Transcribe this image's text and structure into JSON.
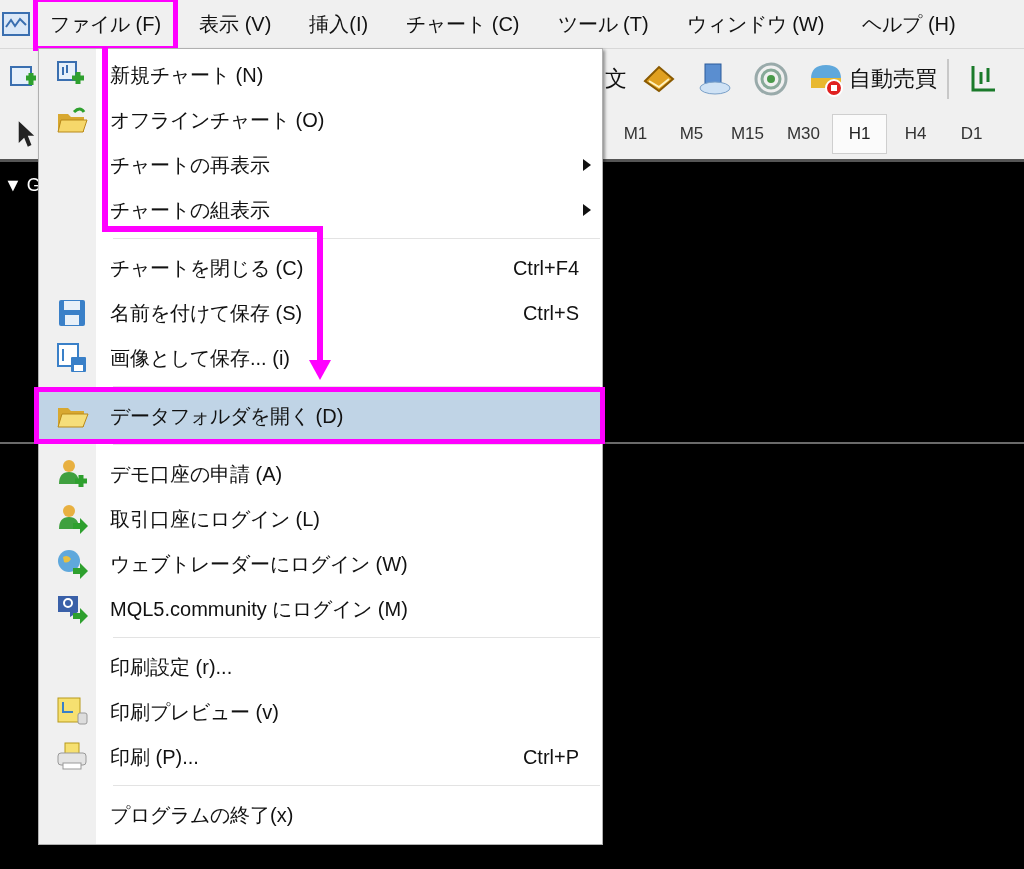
{
  "menubar": [
    {
      "label": "ファイル (F)",
      "highlighted": true
    },
    {
      "label": "表示 (V)",
      "highlighted": false
    },
    {
      "label": "挿入(I)",
      "highlighted": false
    },
    {
      "label": "チャート (C)",
      "highlighted": false
    },
    {
      "label": "ツール (T)",
      "highlighted": false
    },
    {
      "label": "ウィンドウ (W)",
      "highlighted": false
    },
    {
      "label": "ヘルプ (H)",
      "highlighted": false
    }
  ],
  "toolbar": {
    "cut_label": "文",
    "auto_trading": "自動売買"
  },
  "timeframes": [
    {
      "label": "M1",
      "selected": false
    },
    {
      "label": "M5",
      "selected": false
    },
    {
      "label": "M15",
      "selected": false
    },
    {
      "label": "M30",
      "selected": false
    },
    {
      "label": "H1",
      "selected": true
    },
    {
      "label": "H4",
      "selected": false
    },
    {
      "label": "D1",
      "selected": false
    }
  ],
  "navigator": {
    "label": "▼ G"
  },
  "file_menu": [
    {
      "kind": "item",
      "label": "新規チャート (N)",
      "submenu": false,
      "selected": false,
      "highlighted": false
    },
    {
      "kind": "item",
      "label": "オフラインチャート (O)",
      "submenu": false,
      "selected": false,
      "highlighted": false
    },
    {
      "kind": "item",
      "label": "チャートの再表示",
      "submenu": true,
      "selected": false,
      "highlighted": false
    },
    {
      "kind": "item",
      "label": "チャートの組表示",
      "submenu": true,
      "selected": false,
      "highlighted": false
    },
    {
      "kind": "separator"
    },
    {
      "kind": "item",
      "label": "チャートを閉じる (C)",
      "shortcut": "Ctrl+F4",
      "submenu": false,
      "selected": false,
      "highlighted": false
    },
    {
      "kind": "item",
      "label": "名前を付けて保存 (S)",
      "shortcut": "Ctrl+S",
      "submenu": false,
      "selected": false,
      "highlighted": false
    },
    {
      "kind": "item",
      "label": "画像として保存... (i)",
      "submenu": false,
      "selected": false,
      "highlighted": false
    },
    {
      "kind": "separator"
    },
    {
      "kind": "item",
      "label": "データフォルダを開く (D)",
      "submenu": false,
      "selected": true,
      "highlighted": true
    },
    {
      "kind": "separator"
    },
    {
      "kind": "item",
      "label": "デモ口座の申請 (A)",
      "submenu": false,
      "selected": false,
      "highlighted": false
    },
    {
      "kind": "item",
      "label": "取引口座にログイン (L)",
      "submenu": false,
      "selected": false,
      "highlighted": false
    },
    {
      "kind": "item",
      "label": "ウェブトレーダーにログイン (W)",
      "submenu": false,
      "selected": false,
      "highlighted": false
    },
    {
      "kind": "item",
      "label": "MQL5.community にログイン (M)",
      "submenu": false,
      "selected": false,
      "highlighted": false
    },
    {
      "kind": "separator"
    },
    {
      "kind": "item",
      "label": "印刷設定 (r)...",
      "submenu": false,
      "selected": false,
      "highlighted": false
    },
    {
      "kind": "item",
      "label": "印刷プレビュー (v)",
      "submenu": false,
      "selected": false,
      "highlighted": false
    },
    {
      "kind": "item",
      "label": "印刷 (P)...",
      "shortcut": "Ctrl+P",
      "submenu": false,
      "selected": false,
      "highlighted": false
    },
    {
      "kind": "separator"
    },
    {
      "kind": "item",
      "label": "プログラムの終了(x)",
      "submenu": false,
      "selected": false,
      "highlighted": false
    }
  ]
}
